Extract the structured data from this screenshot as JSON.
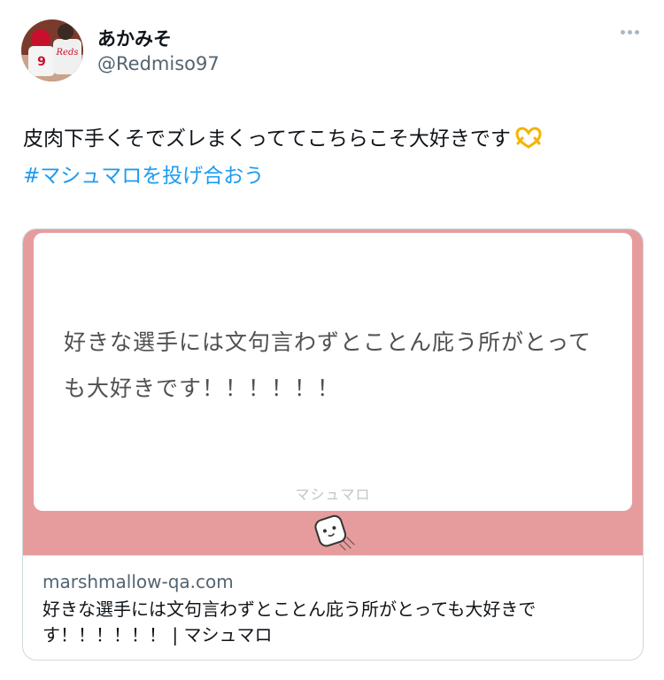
{
  "author": {
    "display_name": "あかみそ",
    "handle": "@Redmiso97",
    "avatar_text": "Reds"
  },
  "tweet": {
    "text": "皮肉下手くそでズレまくっててこちらこそ大好きです",
    "emoji": "heart-hands",
    "hashtag": "#マシュマロを投げ合おう"
  },
  "card": {
    "image_question": "好きな選手には文句言わずとことん庇う所がとっても大好きです！！！！！！",
    "image_brand": "マシュマロ",
    "domain": "marshmallow-qa.com",
    "title": "好きな選手には文句言わずとことん庇う所がとっても大好きです！！！！！！ | マシュマロ"
  },
  "colors": {
    "accent": "#1d9bf0",
    "card_frame": "#e69c9d",
    "secondary_text": "#536471"
  }
}
